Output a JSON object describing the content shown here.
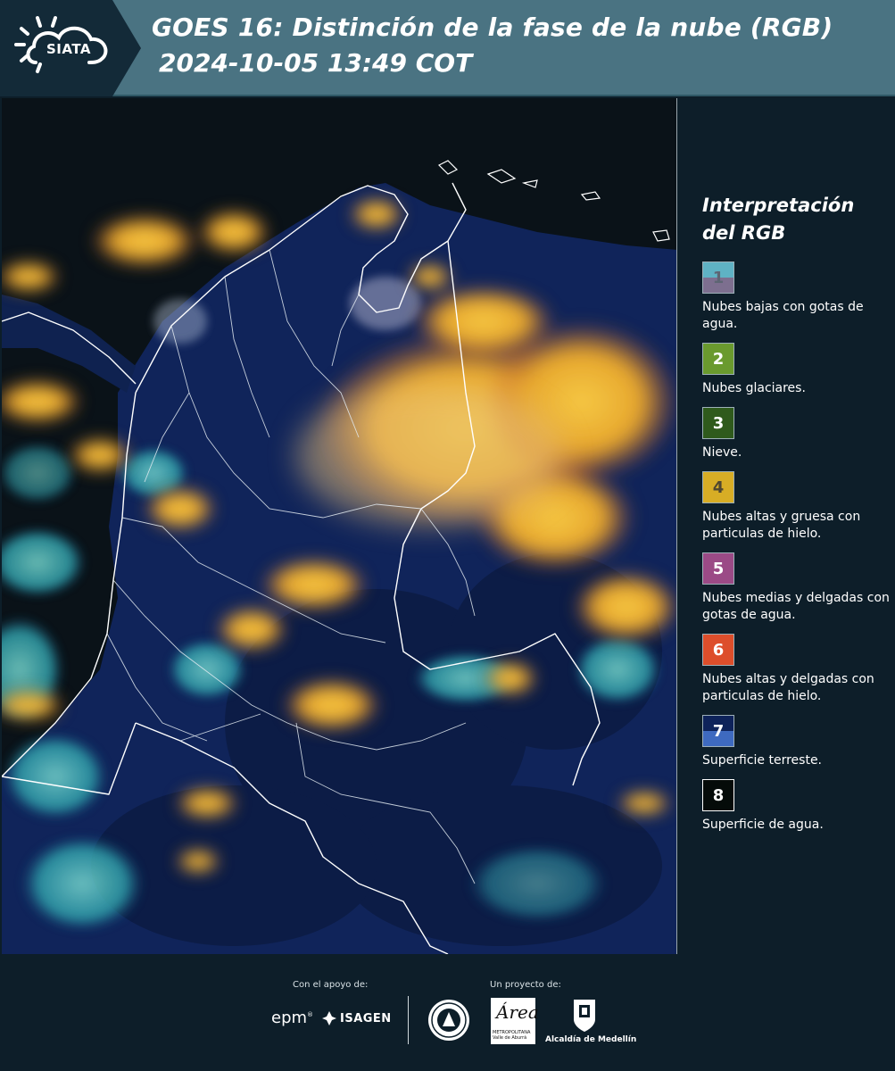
{
  "header": {
    "logo_text": "SIATA",
    "title_line1": "GOES 16: Distinción de la fase de la nube (RGB)",
    "title_line2": "2024-10-05 13:49 COT",
    "colors": {
      "bar": "#4a7382",
      "logo_block": "#132a38"
    }
  },
  "map": {
    "description_icon": "satellite-rgb-map",
    "colors": {
      "ocean": "#0b1420",
      "land": "#11265a",
      "clouds_high": "#e8b02c",
      "clouds_low": "#5ec8c4",
      "borders": "#ffffff"
    }
  },
  "legend": {
    "title": "Interpretación del RGB",
    "items": [
      {
        "num": "1",
        "label": "Nubes bajas con gotas de agua.",
        "colors": [
          "#5fb2c4",
          "#7d6f8f"
        ]
      },
      {
        "num": "2",
        "label": "Nubes glaciares.",
        "colors": [
          "#6a9a2e"
        ]
      },
      {
        "num": "3",
        "label": "Nieve.",
        "colors": [
          "#2f5a1c"
        ]
      },
      {
        "num": "4",
        "label": "Nubes altas y gruesa con particulas de hielo.",
        "colors": [
          "#d7ad25"
        ]
      },
      {
        "num": "5",
        "label": "Nubes medias y delgadas con gotas de agua.",
        "colors": [
          "#9b4a86"
        ]
      },
      {
        "num": "6",
        "label": "Nubes altas y delgadas con particulas de hielo.",
        "colors": [
          "#dd4e2b"
        ]
      },
      {
        "num": "7",
        "label": "Superficie terreste.",
        "colors": [
          "#0e235a",
          "#3e6ac0"
        ]
      },
      {
        "num": "8",
        "label": "Superficie de agua.",
        "colors": [
          "#050b09"
        ]
      }
    ]
  },
  "footer": {
    "support_label": "Con el apoyo de:",
    "project_label": "Un proyecto de:",
    "epm": "epm",
    "isagen": "ISAGEN",
    "area_mark": "Área",
    "area_sub": "METROPOLITANA Valle de Aburrá",
    "alcaldia": "Alcaldía de Medellín"
  }
}
